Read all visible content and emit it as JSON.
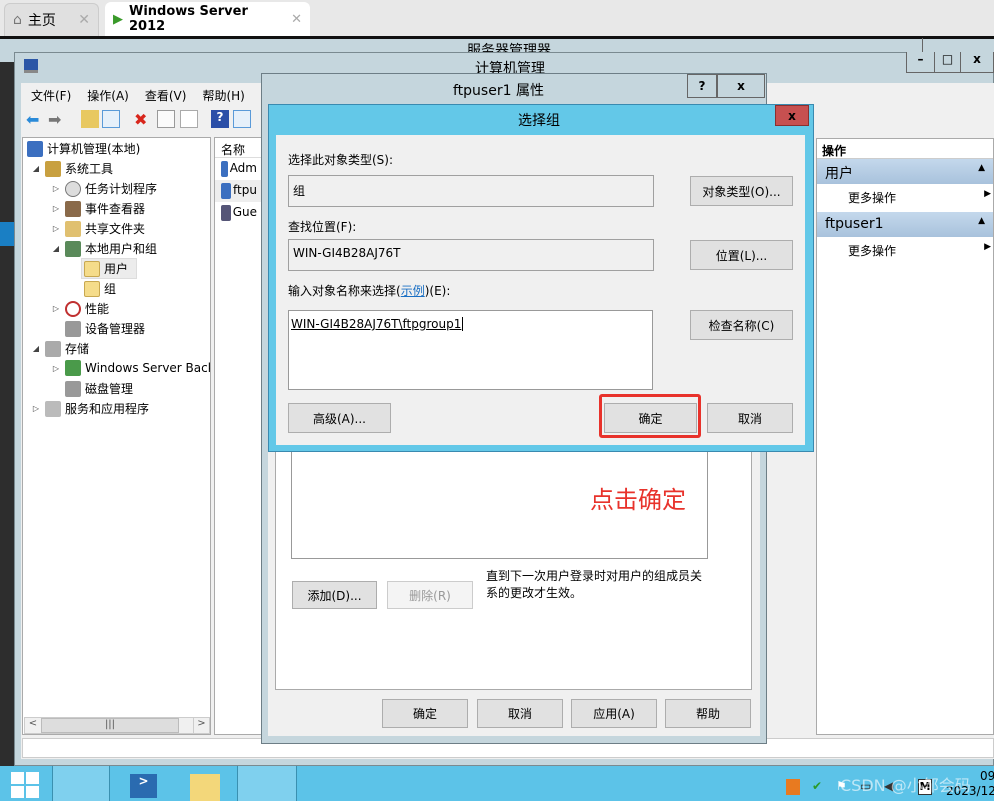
{
  "browser": {
    "tabs": [
      {
        "label": "主页",
        "icon": "home-icon"
      },
      {
        "label": "Windows Server 2012",
        "icon": "vm-icon",
        "active": true
      }
    ]
  },
  "server_manager": {
    "title": "服务器管理器"
  },
  "mmc": {
    "title": "计算机管理",
    "menu": [
      "文件(F)",
      "操作(A)",
      "查看(V)",
      "帮助(H)"
    ],
    "tree": [
      {
        "label": "计算机管理(本地)",
        "level": 0
      },
      {
        "label": "系统工具",
        "level": 1,
        "expanded": true
      },
      {
        "label": "任务计划程序",
        "level": 2
      },
      {
        "label": "事件查看器",
        "level": 2
      },
      {
        "label": "共享文件夹",
        "level": 2
      },
      {
        "label": "本地用户和组",
        "level": 2,
        "expanded": true
      },
      {
        "label": "用户",
        "level": 3,
        "selected": true
      },
      {
        "label": "组",
        "level": 3
      },
      {
        "label": "性能",
        "level": 2
      },
      {
        "label": "设备管理器",
        "level": 2
      },
      {
        "label": "存储",
        "level": 1,
        "expanded": true
      },
      {
        "label": "Windows Server Back",
        "level": 2
      },
      {
        "label": "磁盘管理",
        "level": 2
      },
      {
        "label": "服务和应用程序",
        "level": 1
      }
    ],
    "list": {
      "header": "名称",
      "rows": [
        "Adm",
        "ftpu",
        "Gue"
      ]
    },
    "actions": {
      "header": "操作",
      "sections": [
        {
          "title": "用户",
          "item": "更多操作"
        },
        {
          "title": "ftpuser1",
          "item": "更多操作"
        }
      ]
    }
  },
  "props": {
    "title": "ftpuser1 属性",
    "help": "?",
    "close": "x",
    "note": "直到下一次用户登录时对用户的组成员关系的更改才生效。",
    "add": "添加(D)...",
    "remove": "删除(R)",
    "ok": "确定",
    "cancel": "取消",
    "apply": "应用(A)",
    "helpbtn": "帮助"
  },
  "select_group": {
    "title": "选择组",
    "close": "x",
    "type_label": "选择此对象类型(S):",
    "type_value": "组",
    "type_button": "对象类型(O)...",
    "loc_label": "查找位置(F):",
    "loc_value": "WIN-GI4B28AJ76T",
    "loc_button": "位置(L)...",
    "name_label_pre": "输入对象名称来选择(",
    "name_label_link": "示例",
    "name_label_post": ")(E):",
    "name_value": "WIN-GI4B28AJ76T\\ftpgroup1",
    "check_button": "检查名称(C)",
    "advanced": "高级(A)...",
    "ok": "确定",
    "cancel": "取消"
  },
  "annotation": {
    "text": "点击确定",
    "color": "#e8322b"
  },
  "taskbar": {
    "clock_time": "09",
    "clock_date": "2023/12",
    "watermark": "CSDN @小邹会码"
  },
  "colors": {
    "dialog_border": "#63c8e8",
    "close_red": "#c75050",
    "taskbar": "#5cc3e8"
  }
}
